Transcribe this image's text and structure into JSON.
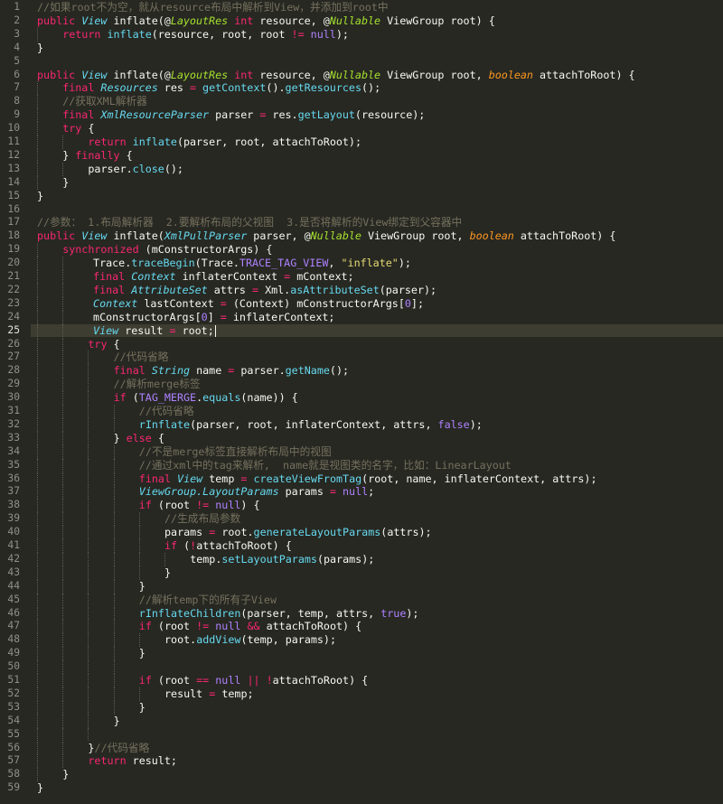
{
  "editor": {
    "cursor_line": 25,
    "theme_colors": {
      "background": "#272822",
      "keyword": "#f92672",
      "type": "#66d9ef",
      "string": "#e6db74",
      "number": "#ae81ff",
      "comment": "#75715e",
      "param": "#fd971f",
      "annotation": "#a6e22e"
    },
    "lines": [
      {
        "n": "1",
        "indent": 0,
        "tokens": [
          [
            "cm",
            "//如果root不为空，就从resource布局中解析到View，并添加到root中"
          ]
        ]
      },
      {
        "n": "2",
        "indent": 0,
        "tokens": [
          [
            "kw",
            "public"
          ],
          [
            "plain",
            " "
          ],
          [
            "ty",
            "View"
          ],
          [
            "plain",
            " inflate(@"
          ],
          [
            "ann",
            "LayoutRes"
          ],
          [
            "plain",
            " "
          ],
          [
            "kw",
            "int"
          ],
          [
            "plain",
            " resource, @"
          ],
          [
            "ann",
            "Nullable"
          ],
          [
            "plain",
            " ViewGroup root) {"
          ]
        ]
      },
      {
        "n": "3",
        "indent": 1,
        "tokens": [
          [
            "kw",
            "return"
          ],
          [
            "plain",
            " "
          ],
          [
            "fn",
            "inflate"
          ],
          [
            "plain",
            "(resource, root, root "
          ],
          [
            "op",
            "!="
          ],
          [
            "plain",
            " "
          ],
          [
            "cst",
            "null"
          ],
          [
            "plain",
            ");"
          ]
        ]
      },
      {
        "n": "4",
        "indent": 0,
        "tokens": [
          [
            "plain",
            "}"
          ]
        ]
      },
      {
        "n": "5",
        "indent": 0,
        "tokens": []
      },
      {
        "n": "6",
        "indent": 0,
        "tokens": [
          [
            "kw",
            "public"
          ],
          [
            "plain",
            " "
          ],
          [
            "ty",
            "View"
          ],
          [
            "plain",
            " inflate(@"
          ],
          [
            "ann",
            "LayoutRes"
          ],
          [
            "plain",
            " "
          ],
          [
            "kw",
            "int"
          ],
          [
            "plain",
            " resource, @"
          ],
          [
            "ann",
            "Nullable"
          ],
          [
            "plain",
            " ViewGroup root, "
          ],
          [
            "pl",
            "boolean"
          ],
          [
            "plain",
            " attachToRoot) {"
          ]
        ]
      },
      {
        "n": "7",
        "indent": 1,
        "tokens": [
          [
            "kw",
            "final"
          ],
          [
            "plain",
            " "
          ],
          [
            "ty",
            "Resources"
          ],
          [
            "plain",
            " res "
          ],
          [
            "op",
            "="
          ],
          [
            "plain",
            " "
          ],
          [
            "fn",
            "getContext"
          ],
          [
            "plain",
            "()."
          ],
          [
            "fn",
            "getResources"
          ],
          [
            "plain",
            "();"
          ]
        ]
      },
      {
        "n": "8",
        "indent": 1,
        "tokens": [
          [
            "cm",
            "//获取XML解析器"
          ]
        ]
      },
      {
        "n": "9",
        "indent": 1,
        "tokens": [
          [
            "kw",
            "final"
          ],
          [
            "plain",
            " "
          ],
          [
            "ty",
            "XmlResourceParser"
          ],
          [
            "plain",
            " parser "
          ],
          [
            "op",
            "="
          ],
          [
            "plain",
            " res."
          ],
          [
            "fn",
            "getLayout"
          ],
          [
            "plain",
            "(resource);"
          ]
        ]
      },
      {
        "n": "10",
        "indent": 1,
        "tokens": [
          [
            "kw",
            "try"
          ],
          [
            "plain",
            " {"
          ]
        ]
      },
      {
        "n": "11",
        "indent": 2,
        "tokens": [
          [
            "kw",
            "return"
          ],
          [
            "plain",
            " "
          ],
          [
            "fn",
            "inflate"
          ],
          [
            "plain",
            "(parser, root, attachToRoot);"
          ]
        ]
      },
      {
        "n": "12",
        "indent": 1,
        "tokens": [
          [
            "plain",
            "} "
          ],
          [
            "kw",
            "finally"
          ],
          [
            "plain",
            " {"
          ]
        ]
      },
      {
        "n": "13",
        "indent": 2,
        "tokens": [
          [
            "plain",
            "parser."
          ],
          [
            "fn",
            "close"
          ],
          [
            "plain",
            "();"
          ]
        ]
      },
      {
        "n": "14",
        "indent": 1,
        "tokens": [
          [
            "plain",
            "}"
          ]
        ]
      },
      {
        "n": "15",
        "indent": 0,
        "tokens": [
          [
            "plain",
            "}"
          ]
        ]
      },
      {
        "n": "16",
        "indent": 0,
        "tokens": []
      },
      {
        "n": "17",
        "indent": 0,
        "tokens": [
          [
            "cm",
            "//参数： 1.布局解析器  2.要解析布局的父视图  3.是否将解析的View绑定到父容器中"
          ]
        ]
      },
      {
        "n": "18",
        "indent": 0,
        "tokens": [
          [
            "kw",
            "public"
          ],
          [
            "plain",
            " "
          ],
          [
            "ty",
            "View"
          ],
          [
            "plain",
            " inflate("
          ],
          [
            "ty",
            "XmlPullParser"
          ],
          [
            "plain",
            " parser, @"
          ],
          [
            "ann",
            "Nullable"
          ],
          [
            "plain",
            " ViewGroup root, "
          ],
          [
            "pl",
            "boolean"
          ],
          [
            "plain",
            " attachToRoot) {"
          ]
        ]
      },
      {
        "n": "19",
        "indent": 1,
        "tokens": [
          [
            "kw",
            "synchronized"
          ],
          [
            "plain",
            " (mConstructorArgs) {"
          ]
        ]
      },
      {
        "n": "20",
        "indent": 2.2,
        "tokens": [
          [
            "plain",
            "Trace."
          ],
          [
            "fn",
            "traceBegin"
          ],
          [
            "plain",
            "(Trace."
          ],
          [
            "cst",
            "TRACE_TAG_VIEW"
          ],
          [
            "plain",
            ", "
          ],
          [
            "str",
            "\"inflate\""
          ],
          [
            "plain",
            ");"
          ]
        ]
      },
      {
        "n": "21",
        "indent": 2.2,
        "tokens": [
          [
            "kw",
            "final"
          ],
          [
            "plain",
            " "
          ],
          [
            "ty",
            "Context"
          ],
          [
            "plain",
            " inflaterContext "
          ],
          [
            "op",
            "="
          ],
          [
            "plain",
            " mContext;"
          ]
        ]
      },
      {
        "n": "22",
        "indent": 2.2,
        "tokens": [
          [
            "kw",
            "final"
          ],
          [
            "plain",
            " "
          ],
          [
            "ty",
            "AttributeSet"
          ],
          [
            "plain",
            " attrs "
          ],
          [
            "op",
            "="
          ],
          [
            "plain",
            " Xml."
          ],
          [
            "fn",
            "asAttributeSet"
          ],
          [
            "plain",
            "(parser);"
          ]
        ]
      },
      {
        "n": "23",
        "indent": 2.2,
        "tokens": [
          [
            "ty",
            "Context"
          ],
          [
            "plain",
            " lastContext "
          ],
          [
            "op",
            "="
          ],
          [
            "plain",
            " (Context) mConstructorArgs["
          ],
          [
            "num",
            "0"
          ],
          [
            "plain",
            "];"
          ]
        ]
      },
      {
        "n": "24",
        "indent": 2.2,
        "tokens": [
          [
            "plain",
            "mConstructorArgs["
          ],
          [
            "num",
            "0"
          ],
          [
            "plain",
            "] "
          ],
          [
            "op",
            "="
          ],
          [
            "plain",
            " inflaterContext;"
          ]
        ]
      },
      {
        "n": "25",
        "indent": 2.2,
        "tokens": [
          [
            "ty",
            "View"
          ],
          [
            "plain",
            " result "
          ],
          [
            "op",
            "="
          ],
          [
            "plain",
            " root;"
          ]
        ]
      },
      {
        "n": "26",
        "indent": 2,
        "tokens": [
          [
            "kw",
            "try"
          ],
          [
            "plain",
            " {"
          ]
        ]
      },
      {
        "n": "27",
        "indent": 3,
        "tokens": [
          [
            "cm",
            "//代码省略"
          ]
        ]
      },
      {
        "n": "28",
        "indent": 3,
        "tokens": [
          [
            "kw",
            "final"
          ],
          [
            "plain",
            " "
          ],
          [
            "ty",
            "String"
          ],
          [
            "plain",
            " name "
          ],
          [
            "op",
            "="
          ],
          [
            "plain",
            " parser."
          ],
          [
            "fn",
            "getName"
          ],
          [
            "plain",
            "();"
          ]
        ]
      },
      {
        "n": "29",
        "indent": 3,
        "tokens": [
          [
            "cm",
            "//解析merge标签"
          ]
        ]
      },
      {
        "n": "30",
        "indent": 3,
        "tokens": [
          [
            "kw",
            "if"
          ],
          [
            "plain",
            " ("
          ],
          [
            "cst",
            "TAG_MERGE"
          ],
          [
            "plain",
            "."
          ],
          [
            "fn",
            "equals"
          ],
          [
            "plain",
            "(name)) {"
          ]
        ]
      },
      {
        "n": "31",
        "indent": 4,
        "tokens": [
          [
            "cm",
            "//代码省略"
          ]
        ]
      },
      {
        "n": "32",
        "indent": 4,
        "tokens": [
          [
            "fn",
            "rInflate"
          ],
          [
            "plain",
            "(parser, root, inflaterContext, attrs, "
          ],
          [
            "cst",
            "false"
          ],
          [
            "plain",
            ");"
          ]
        ]
      },
      {
        "n": "33",
        "indent": 3,
        "tokens": [
          [
            "plain",
            "} "
          ],
          [
            "kw",
            "else"
          ],
          [
            "plain",
            " {"
          ]
        ]
      },
      {
        "n": "34",
        "indent": 4,
        "tokens": [
          [
            "cm",
            "//不是merge标签直接解析布局中的视图"
          ]
        ]
      },
      {
        "n": "35",
        "indent": 4,
        "tokens": [
          [
            "cm",
            "//通过xml中的tag来解析,  name就是视图类的名字，比如：LinearLayout"
          ]
        ]
      },
      {
        "n": "36",
        "indent": 4,
        "tokens": [
          [
            "kw",
            "final"
          ],
          [
            "plain",
            " "
          ],
          [
            "ty",
            "View"
          ],
          [
            "plain",
            " temp "
          ],
          [
            "op",
            "="
          ],
          [
            "plain",
            " "
          ],
          [
            "fn",
            "createViewFromTag"
          ],
          [
            "plain",
            "(root, name, inflaterContext, attrs);"
          ]
        ]
      },
      {
        "n": "37",
        "indent": 4,
        "tokens": [
          [
            "ty",
            "ViewGroup.LayoutParams"
          ],
          [
            "plain",
            " params "
          ],
          [
            "op",
            "="
          ],
          [
            "plain",
            " "
          ],
          [
            "cst",
            "null"
          ],
          [
            "plain",
            ";"
          ]
        ]
      },
      {
        "n": "38",
        "indent": 4,
        "tokens": [
          [
            "kw",
            "if"
          ],
          [
            "plain",
            " (root "
          ],
          [
            "op",
            "!="
          ],
          [
            "plain",
            " "
          ],
          [
            "cst",
            "null"
          ],
          [
            "plain",
            ") {"
          ]
        ]
      },
      {
        "n": "39",
        "indent": 5,
        "tokens": [
          [
            "cm",
            "//生成布局参数"
          ]
        ]
      },
      {
        "n": "40",
        "indent": 5,
        "tokens": [
          [
            "plain",
            "params "
          ],
          [
            "op",
            "="
          ],
          [
            "plain",
            " root."
          ],
          [
            "fn",
            "generateLayoutParams"
          ],
          [
            "plain",
            "(attrs);"
          ]
        ]
      },
      {
        "n": "41",
        "indent": 5,
        "tokens": [
          [
            "kw",
            "if"
          ],
          [
            "plain",
            " ("
          ],
          [
            "op",
            "!"
          ],
          [
            "plain",
            "attachToRoot) {"
          ]
        ]
      },
      {
        "n": "42",
        "indent": 6,
        "tokens": [
          [
            "plain",
            "temp."
          ],
          [
            "fn",
            "setLayoutParams"
          ],
          [
            "plain",
            "(params);"
          ]
        ]
      },
      {
        "n": "43",
        "indent": 5,
        "tokens": [
          [
            "plain",
            "}"
          ]
        ]
      },
      {
        "n": "44",
        "indent": 4,
        "tokens": [
          [
            "plain",
            "}"
          ]
        ]
      },
      {
        "n": "45",
        "indent": 4,
        "tokens": [
          [
            "cm",
            "//解析temp下的所有子View"
          ]
        ]
      },
      {
        "n": "46",
        "indent": 4,
        "tokens": [
          [
            "fn",
            "rInflateChildren"
          ],
          [
            "plain",
            "(parser, temp, attrs, "
          ],
          [
            "cst",
            "true"
          ],
          [
            "plain",
            ");"
          ]
        ]
      },
      {
        "n": "47",
        "indent": 4,
        "tokens": [
          [
            "kw",
            "if"
          ],
          [
            "plain",
            " (root "
          ],
          [
            "op",
            "!="
          ],
          [
            "plain",
            " "
          ],
          [
            "cst",
            "null"
          ],
          [
            "plain",
            " "
          ],
          [
            "op",
            "&&"
          ],
          [
            "plain",
            " attachToRoot) {"
          ]
        ]
      },
      {
        "n": "48",
        "indent": 5,
        "tokens": [
          [
            "plain",
            "root."
          ],
          [
            "fn",
            "addView"
          ],
          [
            "plain",
            "(temp, params);"
          ]
        ]
      },
      {
        "n": "49",
        "indent": 4,
        "tokens": [
          [
            "plain",
            "}"
          ]
        ]
      },
      {
        "n": "50",
        "indent": 4,
        "tokens": []
      },
      {
        "n": "51",
        "indent": 4,
        "tokens": [
          [
            "kw",
            "if"
          ],
          [
            "plain",
            " (root "
          ],
          [
            "op",
            "=="
          ],
          [
            "plain",
            " "
          ],
          [
            "cst",
            "null"
          ],
          [
            "plain",
            " "
          ],
          [
            "op",
            "||"
          ],
          [
            "plain",
            " "
          ],
          [
            "op",
            "!"
          ],
          [
            "plain",
            "attachToRoot) {"
          ]
        ]
      },
      {
        "n": "52",
        "indent": 5,
        "tokens": [
          [
            "plain",
            "result "
          ],
          [
            "op",
            "="
          ],
          [
            "plain",
            " temp;"
          ]
        ]
      },
      {
        "n": "53",
        "indent": 4,
        "tokens": [
          [
            "plain",
            "}"
          ]
        ]
      },
      {
        "n": "54",
        "indent": 3,
        "tokens": [
          [
            "plain",
            "}"
          ]
        ]
      },
      {
        "n": "55",
        "indent": 3,
        "tokens": []
      },
      {
        "n": "56",
        "indent": 2,
        "tokens": [
          [
            "plain",
            "}"
          ],
          [
            "cm",
            "//代码省略"
          ]
        ]
      },
      {
        "n": "57",
        "indent": 2,
        "tokens": [
          [
            "kw",
            "return"
          ],
          [
            "plain",
            " result;"
          ]
        ]
      },
      {
        "n": "58",
        "indent": 1,
        "tokens": [
          [
            "plain",
            "}"
          ]
        ]
      },
      {
        "n": "59",
        "indent": 0,
        "tokens": [
          [
            "plain",
            "}"
          ]
        ]
      }
    ]
  }
}
